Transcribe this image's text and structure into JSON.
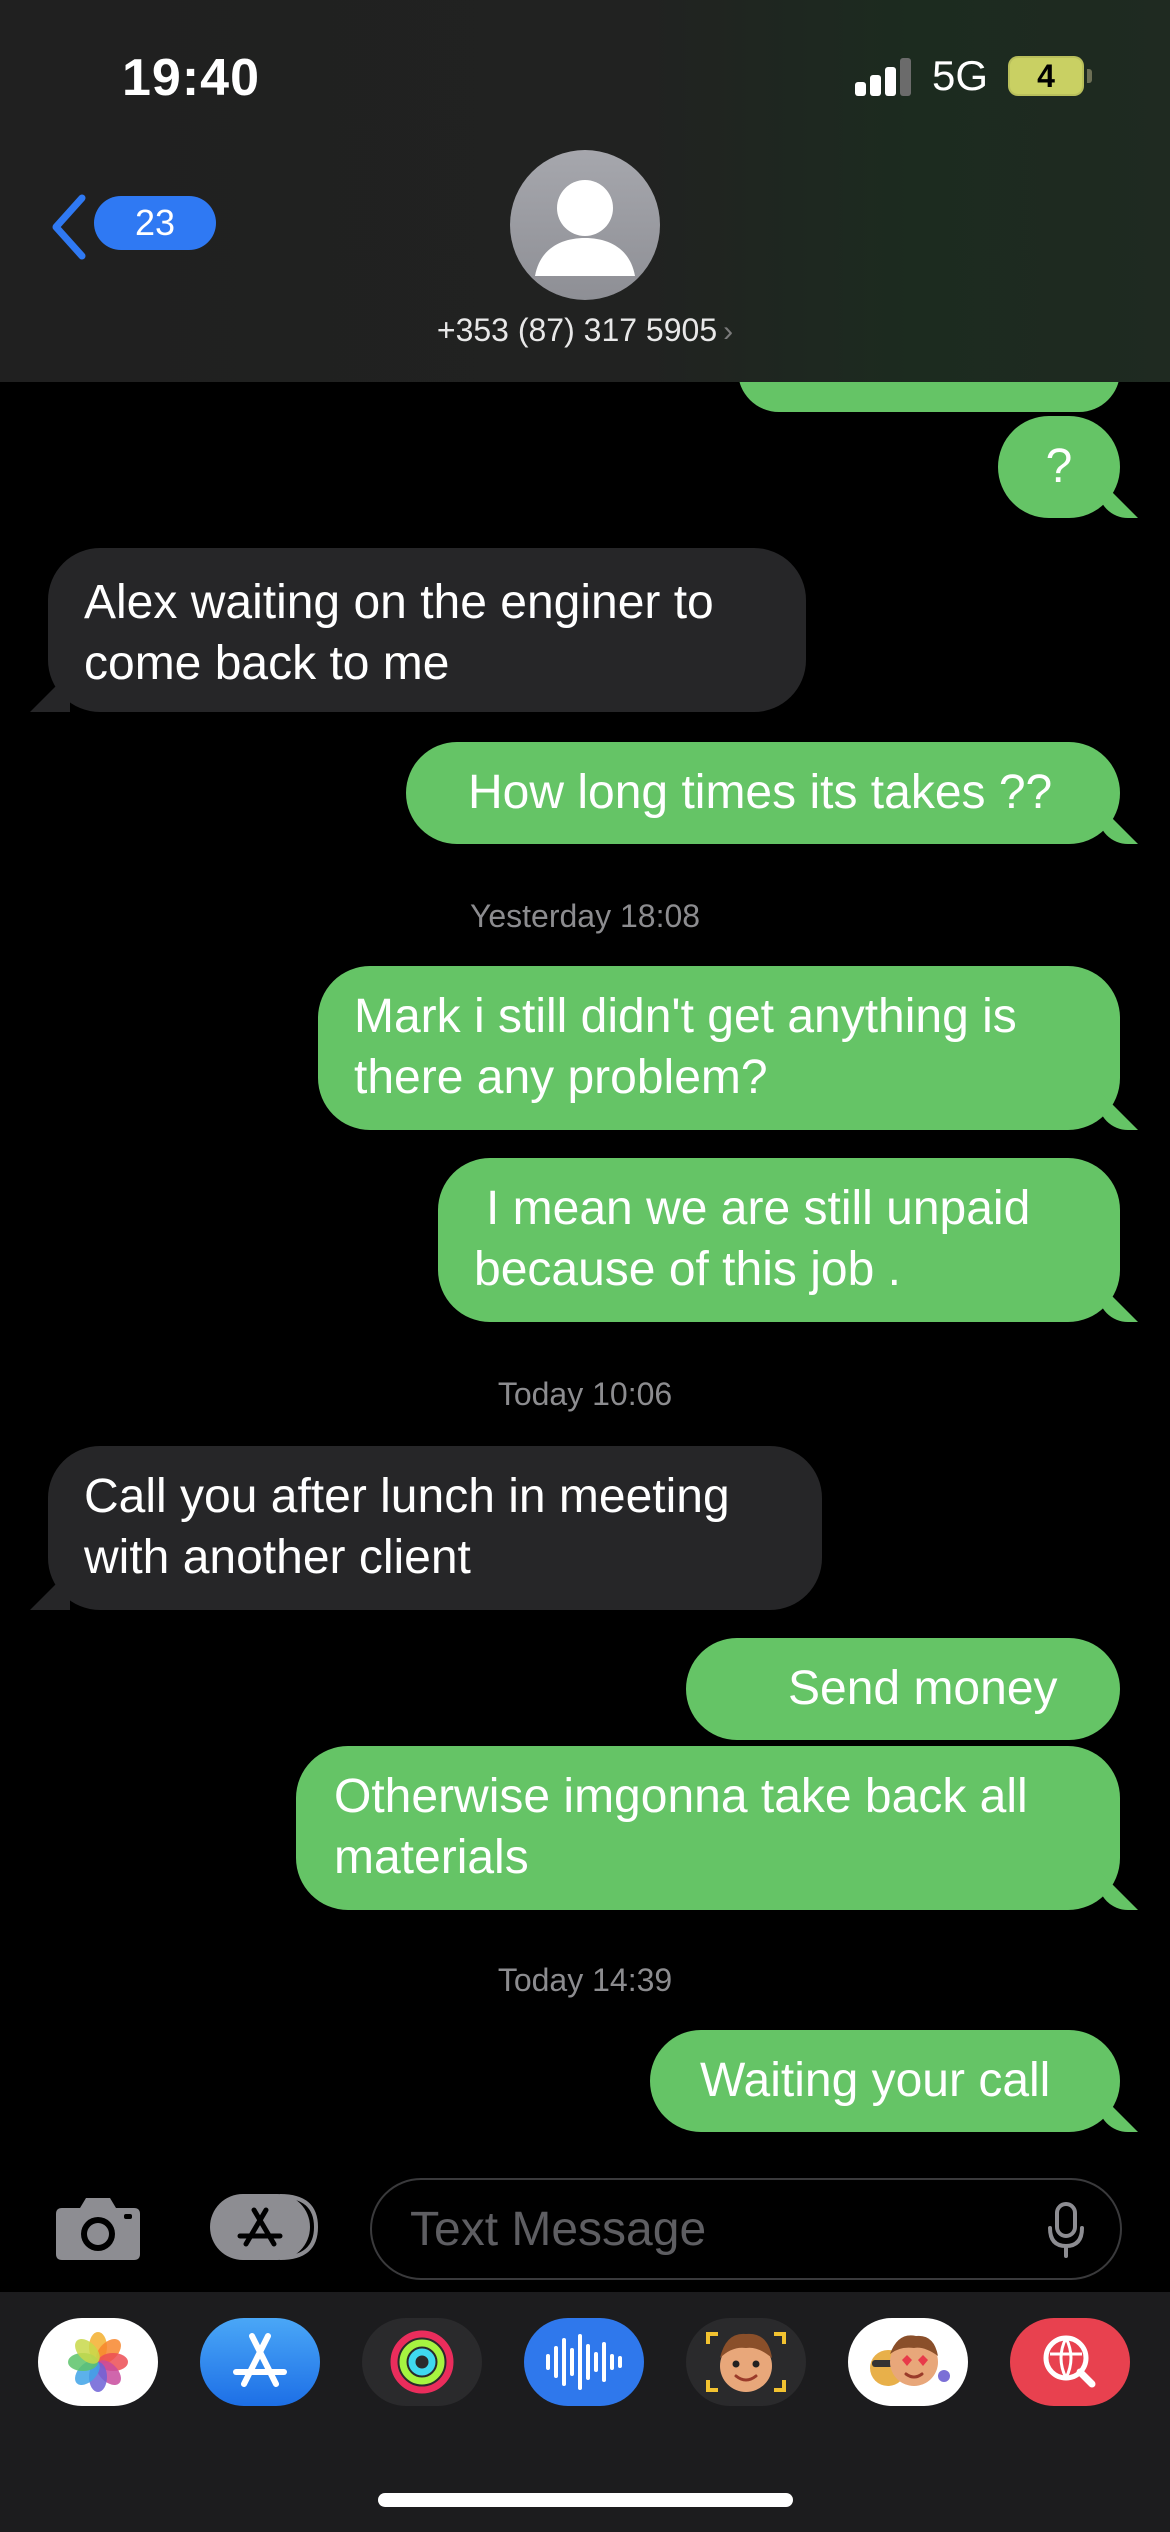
{
  "status_bar": {
    "time": "19:40",
    "network": "5G",
    "battery": "4"
  },
  "header": {
    "back_count": "23",
    "contact": "+353 (87) 317 5905",
    "contact_chevron": "›"
  },
  "messages": [
    {
      "from": "me",
      "text": "?"
    },
    {
      "from": "them",
      "lines": [
        "Alex waiting on the enginer to",
        "come back to me"
      ]
    },
    {
      "from": "me",
      "text": "How long times its takes ??"
    },
    {
      "timestamp": "Yesterday 18:08"
    },
    {
      "from": "me",
      "lines": [
        "Mark i still didn't get anything is",
        "there any problem?"
      ]
    },
    {
      "from": "me",
      "lines": [
        "I mean  we are still unpaid",
        "because of this job ."
      ]
    },
    {
      "timestamp": "Today 10:06"
    },
    {
      "from": "them",
      "lines": [
        "Call you after lunch in meeting",
        "with another client"
      ]
    },
    {
      "from": "me",
      "text": "Send money"
    },
    {
      "from": "me",
      "lines": [
        "Otherwise imgonna take back all",
        "materials"
      ]
    },
    {
      "timestamp": "Today 14:39"
    },
    {
      "from": "me",
      "text": "Waiting your call"
    }
  ],
  "input": {
    "placeholder": "Text Message"
  },
  "app_drawer": [
    "photos-icon",
    "app-store-icon",
    "activity-icon",
    "audio-message-icon",
    "memoji-icon",
    "memoji-stickers-icon",
    "image-search-icon"
  ],
  "colors": {
    "sent": "#65c466",
    "received": "#262628",
    "accent": "#2f79f3"
  }
}
